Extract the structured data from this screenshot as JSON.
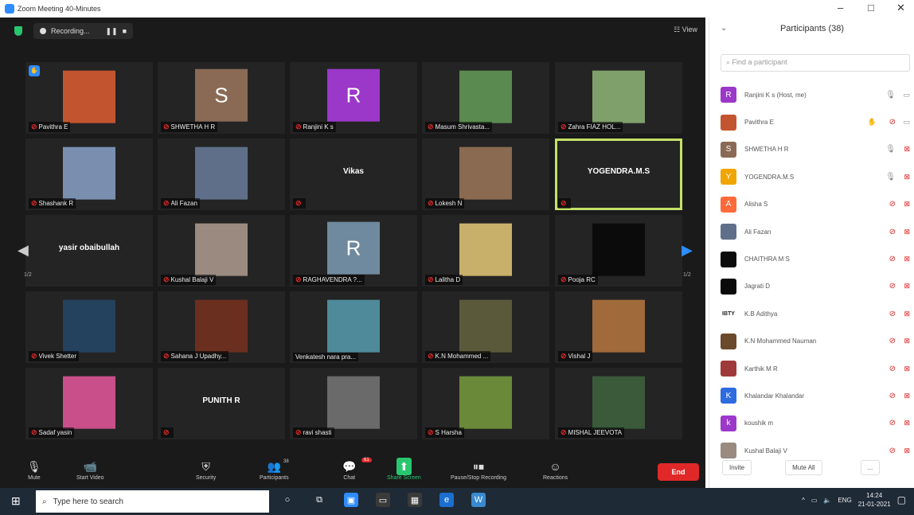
{
  "window": {
    "title": "Zoom Meeting 40-Minutes",
    "minimize": "–",
    "maximize": "□",
    "close": "✕"
  },
  "topbar": {
    "recording": "Recording...",
    "pause": "❚❚",
    "stop": "■",
    "view": "☷ View"
  },
  "grid": {
    "prev_page": "1/2",
    "next_page": "1/2",
    "tiles": [
      {
        "name": "Pavithra E",
        "kind": "photo",
        "color": "#c2552f"
      },
      {
        "name": "SHWETHA H R",
        "kind": "letter",
        "letter": "S",
        "color": "#8a6a55"
      },
      {
        "name": "Ranjini K s",
        "kind": "letter",
        "letter": "R",
        "color": "#9b38c9"
      },
      {
        "name": "Masum Shrivasta...",
        "kind": "photo",
        "color": "#5a8a4f"
      },
      {
        "name": "Zahra FIAZ HOL...",
        "kind": "photo",
        "color": "#7fa06a"
      },
      {
        "name": "Shashank R",
        "kind": "photo",
        "color": "#7a8fb0"
      },
      {
        "name": "Ali Fazan",
        "kind": "photo",
        "color": "#5f6f8a"
      },
      {
        "name": "",
        "kind": "text",
        "big": "Vikas"
      },
      {
        "name": "Lokesh N",
        "kind": "photo",
        "color": "#8a6a50"
      },
      {
        "name": "",
        "kind": "text",
        "big": "YOGENDRA.M.S",
        "active": true
      },
      {
        "name": "",
        "kind": "text",
        "big": "yasir obaibullah",
        "nocap": true
      },
      {
        "name": "Kushal Balaji V",
        "kind": "photo",
        "color": "#9a8a80"
      },
      {
        "name": "RAGHAVENDRA ?...",
        "kind": "letter",
        "letter": "R",
        "color": "#6f8a9e"
      },
      {
        "name": "Lalitha D",
        "kind": "photo",
        "color": "#c9b06a"
      },
      {
        "name": "Pooja RC",
        "kind": "photo",
        "color": "#0b0b0b"
      },
      {
        "name": "Vivek Shetter",
        "kind": "photo",
        "color": "#24415e"
      },
      {
        "name": "Sahana J Upadhy...",
        "kind": "photo",
        "color": "#6a2f1f"
      },
      {
        "name": "Venkatesh nara pra...",
        "kind": "photo",
        "color": "#4f8a9a",
        "nomute": true
      },
      {
        "name": "K.N Mohammed ...",
        "kind": "photo",
        "color": "#5a5a3a"
      },
      {
        "name": "Vishal J",
        "kind": "photo",
        "color": "#a06a3a"
      },
      {
        "name": "Sadaf yasin",
        "kind": "photo",
        "color": "#c84f8a"
      },
      {
        "name": "",
        "kind": "text",
        "big": "PUNITH R"
      },
      {
        "name": "ravi shasti",
        "kind": "photo",
        "color": "#6a6a6a"
      },
      {
        "name": "S Harsha",
        "kind": "photo",
        "color": "#6a8a3a"
      },
      {
        "name": "MISHAL JEEVOTA",
        "kind": "photo",
        "color": "#3a5a3a"
      }
    ]
  },
  "toolbar": {
    "mute": "Mute",
    "start_video": "Start Video",
    "security": "Security",
    "participants": "Participants",
    "participants_count": "38",
    "chat": "Chat",
    "chat_badge": "61",
    "share": "Share Screen",
    "record": "Pause/Stop Recording",
    "reactions": "Reactions",
    "end": "End"
  },
  "panel": {
    "title": "Participants (38)",
    "search_placeholder": "Find a participant",
    "participants": [
      {
        "name": "Ranjini K s (Host, me)",
        "initial": "R",
        "color": "#9b38c9",
        "muted": false,
        "video": true
      },
      {
        "name": "Pavithra E",
        "initial": "",
        "color": "#c2552f",
        "muted": true,
        "video": true,
        "hand": true
      },
      {
        "name": "SHWETHA H R",
        "initial": "S",
        "color": "#8a6a55",
        "muted": false,
        "video": false
      },
      {
        "name": "YOGENDRA.M.S",
        "initial": "Y",
        "color": "#f0a500",
        "muted": false,
        "video": false
      },
      {
        "name": "Alisha S",
        "initial": "A",
        "color": "#ff6a3a",
        "muted": true,
        "video": false
      },
      {
        "name": "Ali Fazan",
        "initial": "",
        "color": "#5f6f8a",
        "muted": true,
        "video": false
      },
      {
        "name": "CHAITHRA M S",
        "initial": "",
        "color": "#0b0b0b",
        "muted": true,
        "video": false
      },
      {
        "name": "Jagrati D",
        "initial": "",
        "color": "#0b0b0b",
        "muted": true,
        "video": false
      },
      {
        "name": "K.B Adithya",
        "initial": "IBTY",
        "color": "#ffffff",
        "muted": true,
        "video": false
      },
      {
        "name": "K.N Mohammed Nauman",
        "initial": "",
        "color": "#6a4a2a",
        "muted": true,
        "video": false
      },
      {
        "name": "Karthik M R",
        "initial": "",
        "color": "#a03a3a",
        "muted": true,
        "video": false
      },
      {
        "name": "Khalandar Khalandar",
        "initial": "K",
        "color": "#2D6CDF",
        "muted": true,
        "video": false
      },
      {
        "name": "koushik m",
        "initial": "k",
        "color": "#9b38c9",
        "muted": true,
        "video": false
      },
      {
        "name": "Kushal Balaji V",
        "initial": "",
        "color": "#9a8a80",
        "muted": true,
        "video": false
      }
    ],
    "invite": "Invite",
    "mute_all": "Mute All",
    "more": "..."
  },
  "taskbar": {
    "search_placeholder": "Type here to search",
    "lang": "ENG",
    "time": "14:24",
    "date": "21-01-2021"
  }
}
